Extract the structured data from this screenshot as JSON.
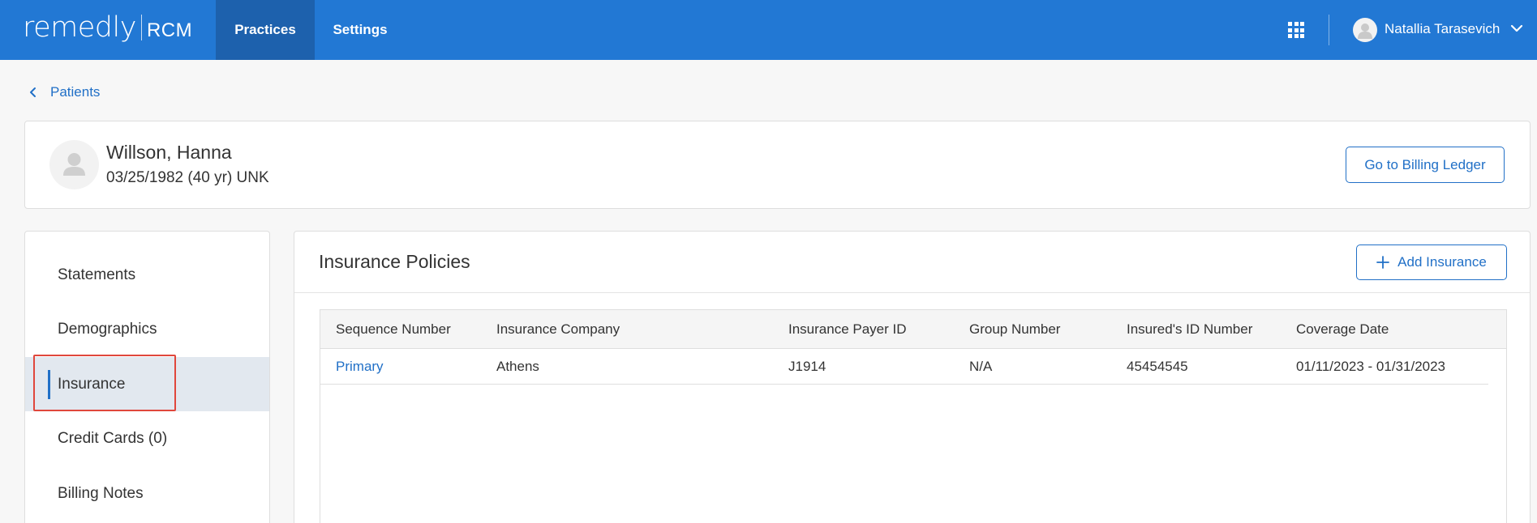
{
  "header": {
    "logo_main": "remedly",
    "logo_sub": "RCM",
    "nav": [
      "Practices",
      "Settings"
    ],
    "active_nav": "Practices",
    "user_name": "Natallia Tarasevich",
    "brand_color": "#2278d4"
  },
  "breadcrumb": {
    "label": "Patients"
  },
  "patient": {
    "name": "Willson, Hanna",
    "details": "03/25/1982 (40 yr) UNK",
    "ledger_button": "Go to Billing Ledger"
  },
  "sidebar": {
    "items": [
      {
        "label": "Statements"
      },
      {
        "label": "Demographics"
      },
      {
        "label": "Insurance"
      },
      {
        "label": "Credit Cards (0)"
      },
      {
        "label": "Billing Notes"
      }
    ],
    "active": "Insurance"
  },
  "insurance": {
    "title": "Insurance Policies",
    "add_button": "Add Insurance",
    "columns": [
      "Sequence Number",
      "Insurance Company",
      "Insurance Payer ID",
      "Group Number",
      "Insured's ID Number",
      "Coverage Date"
    ],
    "rows": [
      [
        "Primary",
        "Athens",
        "J1914",
        "N/A",
        "45454545",
        "01/11/2023 - 01/31/2023"
      ]
    ]
  }
}
